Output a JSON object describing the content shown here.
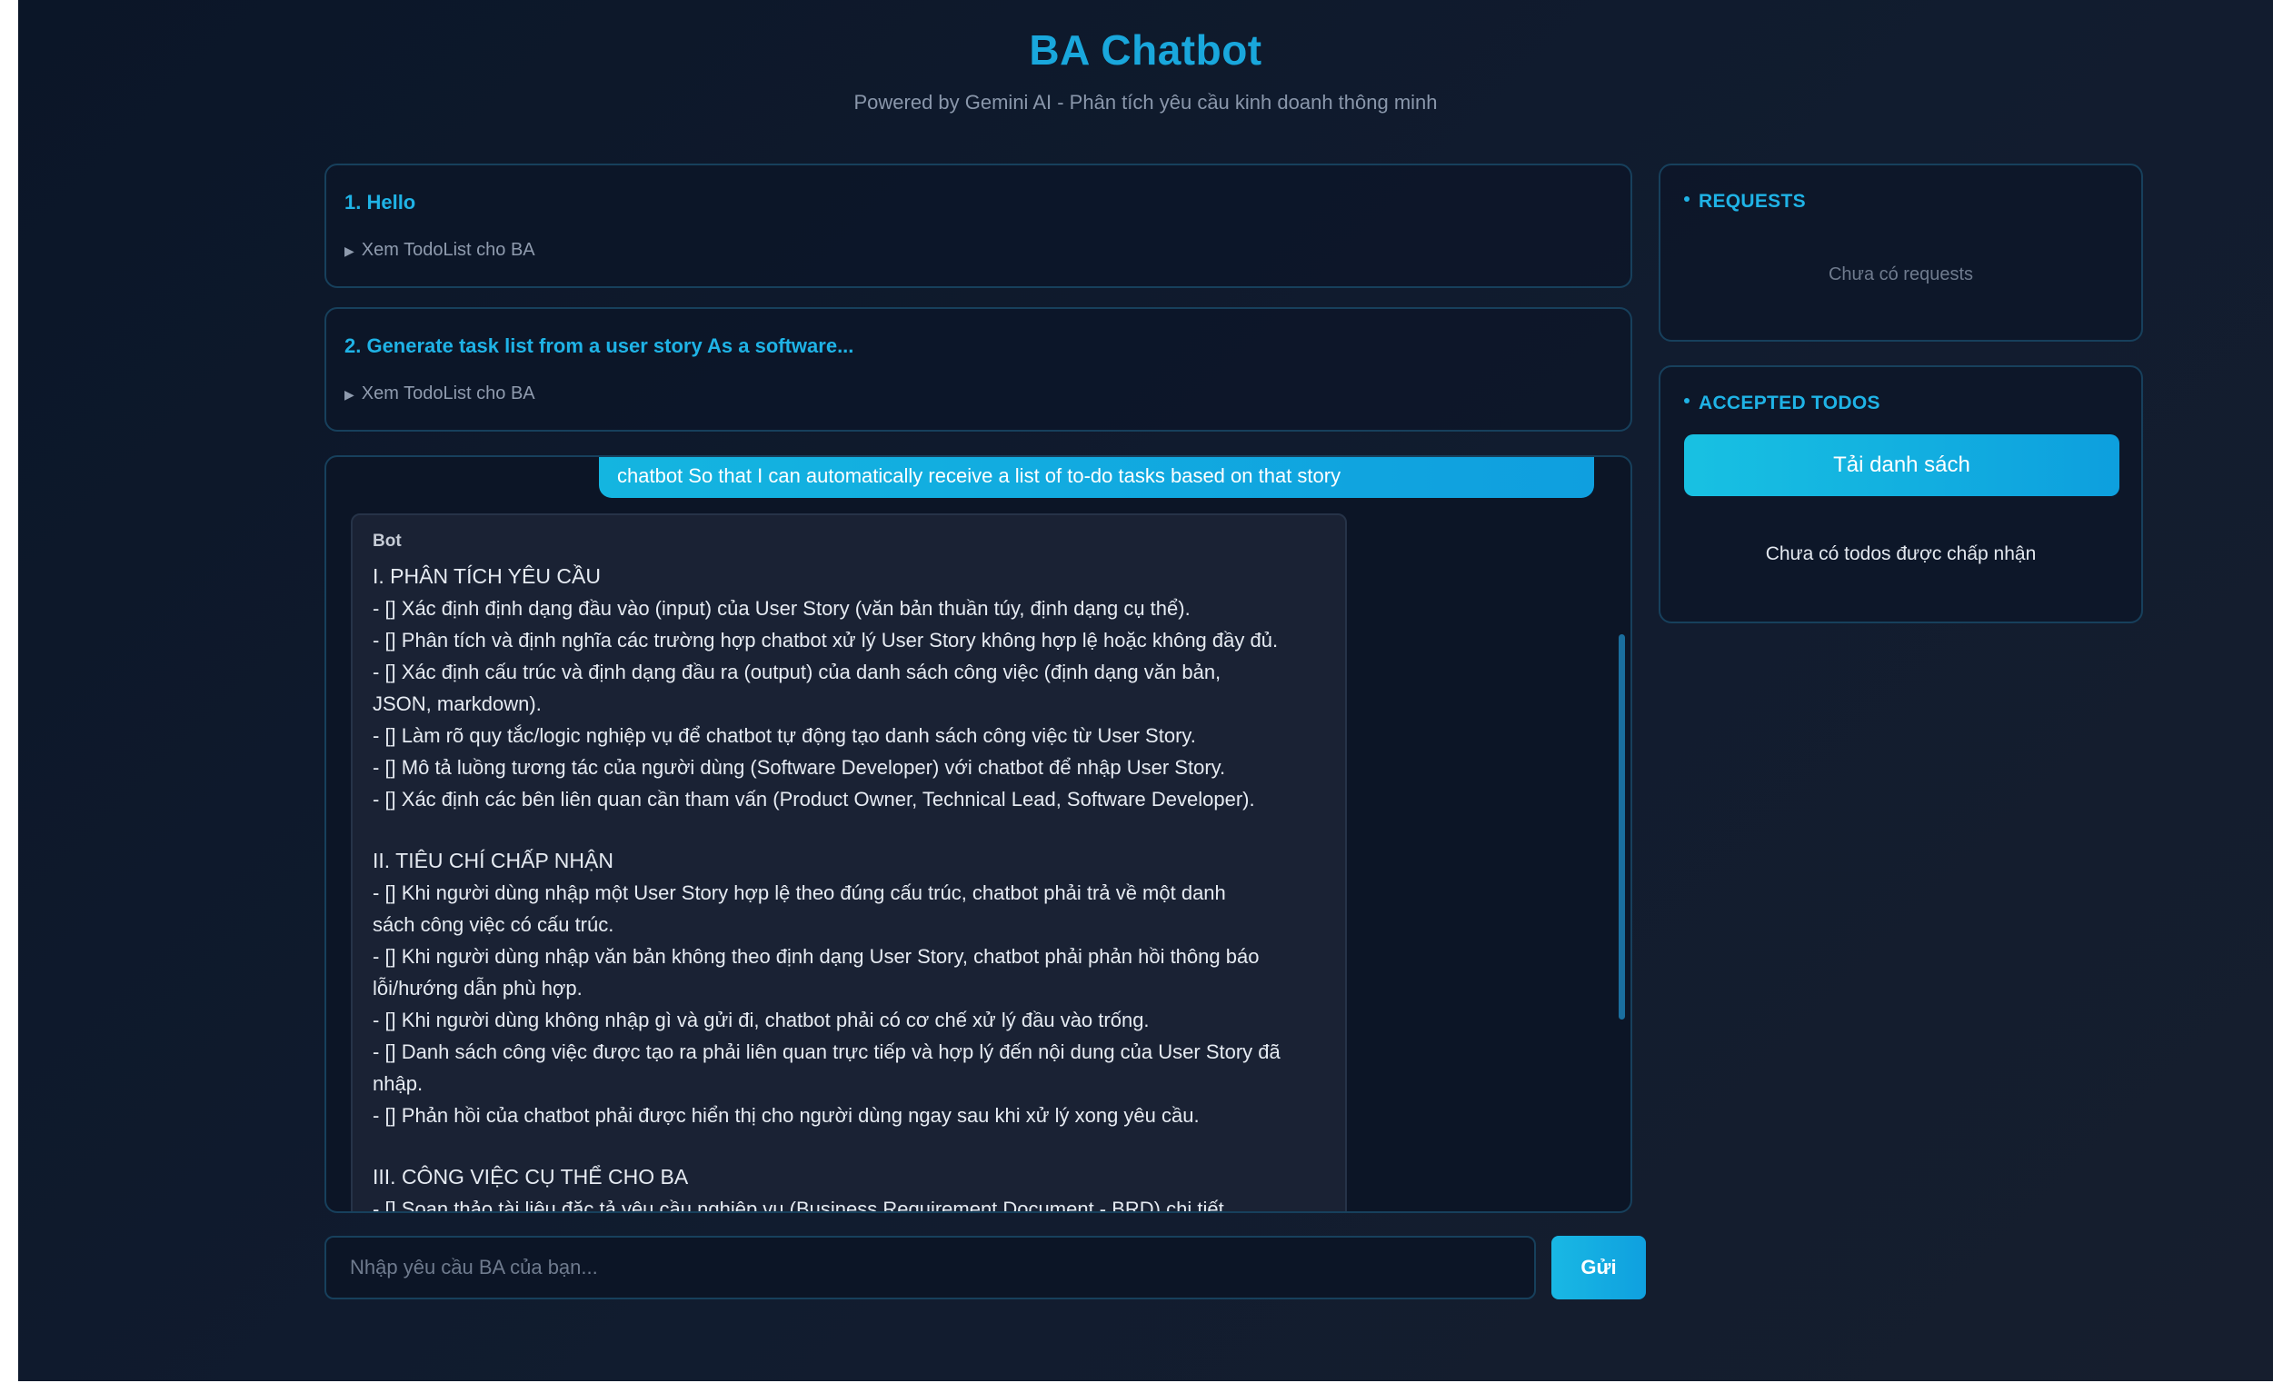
{
  "header": {
    "title": "BA Chatbot",
    "subtitle": "Powered by Gemini AI - Phân tích yêu cầu kinh doanh thông minh"
  },
  "requests_history": [
    {
      "title": "1. Hello",
      "toggle": "Xem TodoList cho BA"
    },
    {
      "title": "2. Generate task list from a user story As a software...",
      "toggle": "Xem TodoList cho BA"
    }
  ],
  "chat": {
    "user_message": "chatbot So that I can automatically receive a list of to-do tasks based on that story",
    "bot_label": "Bot",
    "bot_lines": [
      "I. PHÂN TÍCH YÊU CẦU",
      "- [] Xác định định dạng đầu vào (input) của User Story (văn bản thuần túy, định dạng cụ thể).",
      "- [] Phân tích và định nghĩa các trường hợp chatbot xử lý User Story không hợp lệ hoặc không đầy đủ.",
      "- [] Xác định cấu trúc và định dạng đầu ra (output) của danh sách công việc (định dạng văn bản,",
      "JSON, markdown).",
      "- [] Làm rõ quy tắc/logic nghiệp vụ để chatbot tự động tạo danh sách công việc từ User Story.",
      "- [] Mô tả luồng tương tác của người dùng (Software Developer) với chatbot để nhập User Story.",
      "- [] Xác định các bên liên quan cần tham vấn (Product Owner, Technical Lead, Software Developer).",
      "",
      "II. TIÊU CHÍ CHẤP NHẬN",
      "- [] Khi người dùng nhập một User Story hợp lệ theo đúng cấu trúc, chatbot phải trả về một danh",
      "sách công việc có cấu trúc.",
      "- [] Khi người dùng nhập văn bản không theo định dạng User Story, chatbot phải phản hồi thông báo",
      "lỗi/hướng dẫn phù hợp.",
      "- [] Khi người dùng không nhập gì và gửi đi, chatbot phải có cơ chế xử lý đầu vào trống.",
      "- [] Danh sách công việc được tạo ra phải liên quan trực tiếp và hợp lý đến nội dung của User Story đã",
      "nhập.",
      "- [] Phản hồi của chatbot phải được hiển thị cho người dùng ngay sau khi xử lý xong yêu cầu.",
      "",
      "III. CÔNG VIỆC CỤ THỂ CHO BA",
      "- [] Soạn thảo tài liệu đặc tả yêu cầu nghiệp vụ (Business Requirement Document - BRD) chi tiết."
    ]
  },
  "composer": {
    "placeholder": "Nhập yêu cầu BA của bạn...",
    "send_label": "Gửi"
  },
  "sidebar": {
    "requests": {
      "title": "REQUESTS",
      "empty_text": "Chưa có requests"
    },
    "accepted": {
      "title": "ACCEPTED TODOS",
      "load_label": "Tải danh sách",
      "empty_text": "Chưa có todos được chấp nhận"
    }
  }
}
